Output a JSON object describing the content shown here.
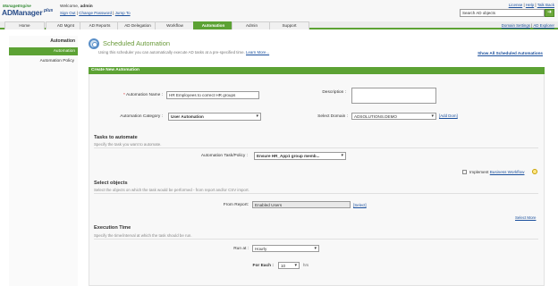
{
  "header": {
    "logo_top": "ManageEngine",
    "logo_main": "ADManager",
    "logo_plus": "plus",
    "welcome_prefix": "Welcome,",
    "user": "admin",
    "links": [
      "Sign Out",
      "Change Password",
      "Jump To"
    ],
    "top_links": [
      "License",
      "Help",
      "Talk Back"
    ],
    "search_placeholder": "Search AD objects"
  },
  "nav": {
    "tabs": [
      "Home",
      "AD Mgmt",
      "AD Reports",
      "AD Delegation",
      "Workflow",
      "Automation",
      "Admin",
      "Support"
    ],
    "active_tab": "Automation",
    "right_links": [
      "Domain Settings",
      "AD Explorer"
    ]
  },
  "sidebar": {
    "heading": "Automation",
    "items": [
      "Automation",
      "Automation Policy"
    ]
  },
  "main": {
    "title": "Scheduled Automation",
    "subtitle": "Using this scheduler you can automatically execute AD tasks at a pre-specified time.",
    "learn_more": "Learn More...",
    "show_all": "Show All Scheduled Automations",
    "panel_title": "Create New Automation"
  },
  "form": {
    "name_label": "Automation Name :",
    "name_value": "HR Employees to correct HR groups",
    "description_label": "Description :",
    "category_label": "Automation Category :",
    "category_value": "User Automation",
    "domain_label": "Select Domain :",
    "domain_value": "ADSOLUTIONS.DEMO",
    "add_domain": "[Add Dom]",
    "tasks_title": "Tasks to automate",
    "tasks_sub": "Specify the task you want to automate.",
    "task_label": "Automation Task/Policy :",
    "task_value": "Ensure HR_App1 group memb...",
    "implement_label": "Implement",
    "business_workflow": "Business Workflow",
    "objects_title": "Select objects",
    "objects_sub": "Select the objects on which the task would be performed - from report and/or CSV import.",
    "from_report_label": "From Report:",
    "from_report_value": "Enabled Users",
    "select_link": "[Select]",
    "select_more": "Select More",
    "exec_title": "Execution Time",
    "exec_sub": "Specify the time/interval at which the task should be run.",
    "run_at_label": "Run at :",
    "run_at_value": "Hourly",
    "for_each_label": "For Each :",
    "for_each_value": "10",
    "for_each_unit": "hrs"
  }
}
